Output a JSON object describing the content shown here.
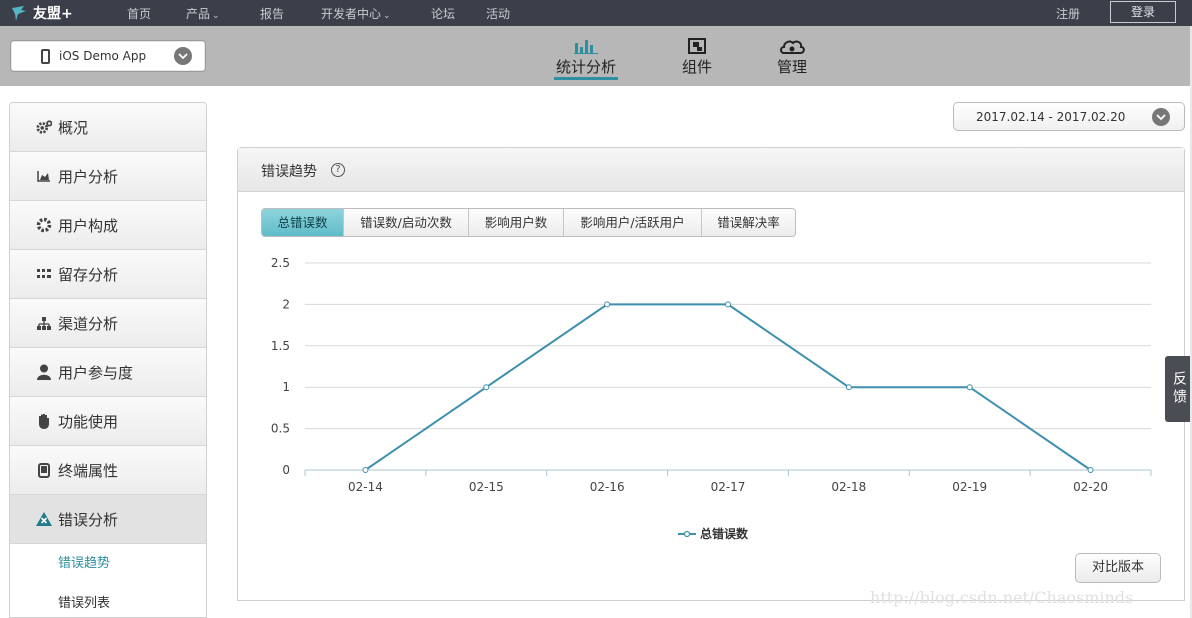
{
  "topnav": {
    "logo_text": "友盟+",
    "links": [
      "首页",
      "产品",
      "报告",
      "开发者中心",
      "论坛",
      "活动"
    ],
    "register": "注册",
    "login": "登录"
  },
  "app_selector": {
    "value": "iOS Demo App"
  },
  "main_tabs": [
    {
      "label": "统计分析",
      "icon": "bar-chart-icon",
      "active": true
    },
    {
      "label": "组件",
      "icon": "component-icon",
      "active": false
    },
    {
      "label": "管理",
      "icon": "cloud-settings-icon",
      "active": false
    }
  ],
  "sidebar": {
    "items": [
      {
        "label": "概况",
        "icon": "gears-icon"
      },
      {
        "label": "用户分析",
        "icon": "area-chart-icon"
      },
      {
        "label": "用户构成",
        "icon": "gear-icon"
      },
      {
        "label": "留存分析",
        "icon": "grid-icon"
      },
      {
        "label": "渠道分析",
        "icon": "sitemap-icon"
      },
      {
        "label": "用户参与度",
        "icon": "user-icon"
      },
      {
        "label": "功能使用",
        "icon": "hand-icon"
      },
      {
        "label": "终端属性",
        "icon": "device-icon"
      },
      {
        "label": "错误分析",
        "icon": "warning-icon",
        "active": true
      }
    ],
    "sub_items": [
      {
        "label": "错误趋势",
        "active": true
      },
      {
        "label": "错误列表",
        "active": false
      }
    ]
  },
  "date_range": "2017.02.14 - 2017.02.20",
  "panel": {
    "title": "错误趋势",
    "help": "?",
    "segments": [
      "总错误数",
      "错误数/启动次数",
      "影响用户数",
      "影响用户/活跃用户",
      "错误解决率"
    ],
    "active_segment": 0,
    "compare_button": "对比版本"
  },
  "chart_data": {
    "type": "line",
    "categories": [
      "02-14",
      "02-15",
      "02-16",
      "02-17",
      "02-18",
      "02-19",
      "02-20"
    ],
    "series": [
      {
        "name": "总错误数",
        "values": [
          0,
          1,
          2,
          2,
          1,
          1,
          0
        ],
        "color": "#3d8fae"
      }
    ],
    "yticks": [
      "0",
      "0.5",
      "1",
      "1.5",
      "2",
      "2.5"
    ],
    "ylim": [
      0,
      2.5
    ],
    "grid": true,
    "legend": "bottom-center"
  },
  "feedback_tab": "反馈",
  "watermark": "http://blog.csdn.net/Chaosminds"
}
